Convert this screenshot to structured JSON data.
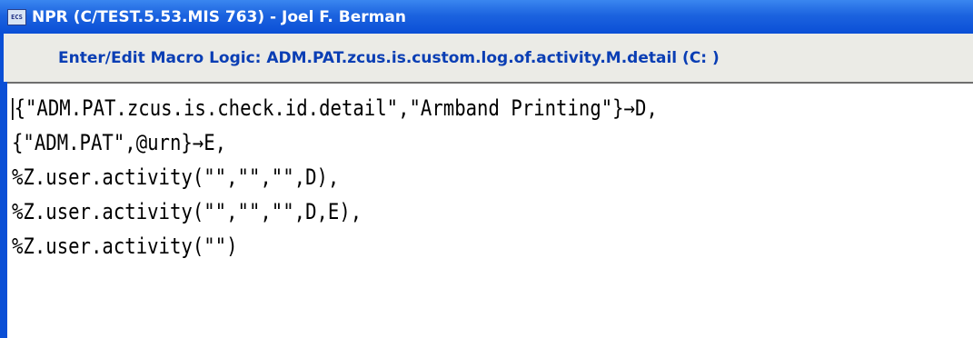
{
  "window": {
    "title": "NPR (C/TEST.5.53.MIS 763) - Joel F. Berman",
    "icon": "app-icon",
    "icon_text": "ECS"
  },
  "header": {
    "title": "Enter/Edit Macro Logic: ADM.PAT.zcus.is.custom.log.of.activity.M.detail  (C: )"
  },
  "editor": {
    "lines": [
      "{\"ADM.PAT.zcus.is.check.id.detail\",\"Armband Printing\"}→D,",
      "{\"ADM.PAT\",@urn}→E,",
      "%Z.user.activity(\"\",\"\",\"\",D),",
      "%Z.user.activity(\"\",\"\",\"\",D,E),",
      "%Z.user.activity(\"\")"
    ]
  },
  "colors": {
    "titlebar": "#0a4fd6",
    "header_text": "#0a3eb4",
    "header_bg": "#ebebe6"
  }
}
